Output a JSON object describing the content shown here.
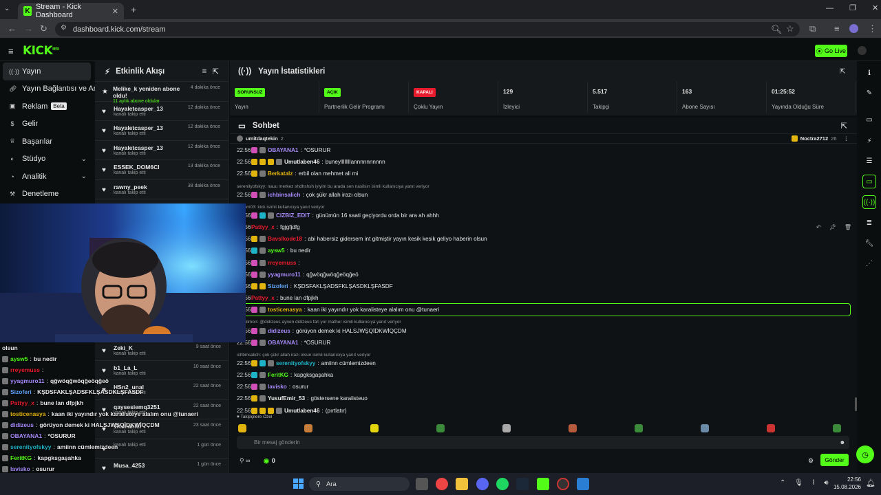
{
  "browser": {
    "tab_title": "Stream - Kick Dashboard",
    "url": "dashboard.kick.com/stream"
  },
  "header": {
    "logo": "KICK",
    "logo_sup": "BETA",
    "go_live": "Go Live"
  },
  "sidebar": {
    "items": [
      {
        "label": "Yayın",
        "icon": "broadcast-icon"
      },
      {
        "label": "Yayın Bağlantısı ve Anahtar",
        "icon": "link-icon"
      },
      {
        "label": "Reklam",
        "icon": "ad-icon",
        "badge": "Beta"
      },
      {
        "label": "Gelir",
        "icon": "dollar-icon"
      },
      {
        "label": "Başarılar",
        "icon": "trophy-icon"
      },
      {
        "label": "Stüdyo",
        "icon": "studio-icon"
      },
      {
        "label": "Analitik",
        "icon": "chart-icon"
      },
      {
        "label": "Denetleme",
        "icon": "hammer-icon"
      }
    ]
  },
  "activity": {
    "title": "Etkinlik Akışı",
    "items": [
      {
        "name": "Melike_k yeniden abone oldu!",
        "sub": "11 aylık abone oldular",
        "time": "4 dakika önce",
        "icon": "star-icon",
        "green": true
      },
      {
        "name": "Hayaletcasper_13",
        "sub": "kanalı takip etti",
        "time": "12 dakika önce",
        "icon": "heart-icon"
      },
      {
        "name": "Hayaletcasper_13",
        "sub": "kanalı takip etti",
        "time": "12 dakika önce",
        "icon": "heart-icon"
      },
      {
        "name": "Hayaletcasper_13",
        "sub": "kanalı takip etti",
        "time": "12 dakika önce",
        "icon": "heart-icon"
      },
      {
        "name": "ESSEK_DOM6CI",
        "sub": "kanalı takip etti",
        "time": "13 dakika önce",
        "icon": "heart-icon"
      },
      {
        "name": "rawny_peek",
        "sub": "kanalı takip etti",
        "time": "38 dakika önce",
        "icon": "heart-icon"
      }
    ],
    "lower_items": [
      {
        "name": "Zeki_K",
        "sub": "kanalı takip etti",
        "time": "9 saat önce"
      },
      {
        "name": "b1_La_L",
        "sub": "kanalı takip etti",
        "time": "10 saat önce"
      },
      {
        "name": "HSn2_unal",
        "sub": "kanalı takip etti",
        "time": "22 saat önce"
      },
      {
        "name": "qaysesiemq3251",
        "sub": "kanalı takip etti",
        "time": "22 saat önce"
      },
      {
        "name": "1Kullanıcı",
        "sub": "kanalı takip etti",
        "time": "23 saat önce"
      },
      {
        "name": "",
        "sub": "kanalı takip etti",
        "time": "1 gün önce"
      },
      {
        "name": "Musa_4253",
        "sub": "",
        "time": "1 gün önce"
      }
    ]
  },
  "stats": {
    "title": "Yayın İstatistikleri",
    "cells": [
      {
        "value": "SORUNSUZ",
        "label": "Yayın",
        "badge": true,
        "color": "#53fc18"
      },
      {
        "value": "AÇIK",
        "label": "Partnerlik Gelir Programı",
        "badge": true,
        "color": "#53fc18"
      },
      {
        "value": "KAPALI",
        "label": "Çoklu Yayın",
        "badge": true,
        "color": "#e81c2c"
      },
      {
        "value": "129",
        "label": "İzleyici"
      },
      {
        "value": "5.517",
        "label": "Takipçi"
      },
      {
        "value": "163",
        "label": "Abone Sayısı"
      },
      {
        "value": "01:25:52",
        "label": "Yayında Olduğu Süre"
      }
    ]
  },
  "chat": {
    "title": "Sohbet",
    "pinned_left": "umitdaqtekin",
    "pinned_left_count": "2",
    "pinned_right": "Noctra2712",
    "pinned_right_count": "26",
    "messages": [
      {
        "time": "22:56",
        "user": "OBAYANA1",
        "color": "#a78bfa",
        "text": "*OSURUR",
        "badges": [
          "pink",
          "gray"
        ]
      },
      {
        "time": "22:56",
        "user": "Umutlaben46",
        "color": "#e8e8e8",
        "text": "buneyllllllllannnnnnnnnn",
        "badges": [
          "yel",
          "yel",
          "yel",
          "gray"
        ]
      },
      {
        "time": "22:56",
        "user": "Berkatalz",
        "color": "#e2b50e",
        "text": "erbil olan mehmet ali mi",
        "badges": [
          "yel",
          "gray"
        ]
      },
      {
        "reply": "serenityofskyy: nauu merkez shdhshsh iyiyim bu arada sen nasilsın isimli kullanıcıya yanıt veriyor"
      },
      {
        "time": "22:56",
        "user": "ichbinsalich",
        "color": "#a78bfa",
        "text": "çok şükr allah irazı olsun",
        "badges": [
          "pink",
          "gray"
        ]
      },
      {
        "reply": "tazmm03: kick isimli kullanıcıya yanıt veriyor"
      },
      {
        "time": "22:56",
        "user": "CIZBIZ_EDIT",
        "color": "#a78bfa",
        "text": "günümün 16 saati geçiyordu orda bir ara ah ahhh",
        "badges": [
          "pink",
          "teal",
          "gray"
        ]
      },
      {
        "time": "22:56",
        "user": "Pattyy_x",
        "color": "#e81c2c",
        "text": "fgjgfjdfg",
        "badges": []
      },
      {
        "time": "22:56",
        "user": "Bavslkode18",
        "color": "#e81c2c",
        "text": "abi habersiz gidersem int gitmiştir yayın kesik kesik geliyo haberin olsun",
        "badges": [
          "yel",
          "gray"
        ]
      },
      {
        "time": "22:56",
        "user": "aysw5",
        "color": "#53fc18",
        "text": "bu nedir",
        "badges": [
          "teal",
          "gray"
        ]
      },
      {
        "time": "22:56",
        "user": "rreyemuss",
        "color": "#e81c2c",
        "text": "",
        "badges": [
          "pink",
          "gray"
        ]
      },
      {
        "time": "22:56",
        "user": "yyagmuro11",
        "color": "#a78bfa",
        "text": "qğwöqğwöqğeöqğeö",
        "badges": [
          "pink",
          "gray"
        ]
      },
      {
        "time": "22:56",
        "user": "Sizoferi",
        "color": "#60a5fa",
        "text": "KŞDSFAKLŞADSFKLŞASDKLŞFASDF",
        "badges": [
          "yel",
          "yel"
        ]
      },
      {
        "time": "22:56",
        "user": "Pattyy_x",
        "color": "#e81c2c",
        "text": "bune lan dfpjkh",
        "badges": []
      },
      {
        "time": "22:56",
        "user": "tosticenasya",
        "color": "#e2b50e",
        "text": "kaan iki yayındır yok karalisteye alalım onu @tunaeri",
        "badges": [
          "pink",
          "gray"
        ],
        "highlight": true
      },
      {
        "reply": "stofolimon: @didizeus aynen didizeus fah yor mather isimli kullanıcıya yanıt veriyor"
      },
      {
        "time": "22:56",
        "user": "didizeus",
        "color": "#a78bfa",
        "text": "görüyon demek ki HALSJWŞQİDKWİQÇDM",
        "badges": [
          "pink",
          "gray"
        ]
      },
      {
        "time": "22:56",
        "user": "OBAYANA1",
        "color": "#a78bfa",
        "text": "*OSURUR",
        "badges": [
          "pink",
          "gray"
        ]
      },
      {
        "reply": "ichbinsalich: çok şükr allah irazı olsun isimli kullanıcıya yanıt veriyor"
      },
      {
        "time": "22:56",
        "user": "serenityofskyy",
        "color": "#1fb3c7",
        "text": "amiinn cümlemizdeen",
        "badges": [
          "yel",
          "teal",
          "gray"
        ]
      },
      {
        "time": "22:56",
        "user": "FeritKG",
        "color": "#53fc18",
        "text": "kapgksgaşahka",
        "badges": [
          "teal",
          "gray"
        ]
      },
      {
        "time": "22:56",
        "user": "lavisko",
        "color": "#a78bfa",
        "text": "osurur",
        "badges": [
          "pink",
          "gray"
        ]
      },
      {
        "time": "22:56",
        "user": "YusufEmir_53",
        "color": "#e8e8e8",
        "text": "göstersene karalisteuo",
        "badges": [
          "yel",
          "gray"
        ]
      },
      {
        "time": "22:56",
        "user": "Umutlaben46",
        "color": "#e8e8e8",
        "text": "(pırtlatır)",
        "badges": [
          "yel",
          "yel",
          "yel",
          "gray"
        ]
      }
    ],
    "emote_label": "Takipçilere Özel",
    "input_placeholder": "Bir mesaj gönderin",
    "points": "0",
    "send": "Gönder"
  },
  "overlay_chat": [
    {
      "user": "",
      "text": "olsun",
      "color": "#e8e8e8"
    },
    {
      "user": "aysw5",
      "text": "bu nedir",
      "color": "#53fc18"
    },
    {
      "user": "rreyemuss",
      "text": "",
      "color": "#e81c2c"
    },
    {
      "user": "yyagmuro11",
      "text": "qğwöqğwöqğeöqğeö",
      "color": "#a78bfa"
    },
    {
      "user": "Sizoferi",
      "text": "KŞDSFAKLŞADSFKLŞASDKLŞFASDF",
      "color": "#60a5fa"
    },
    {
      "user": "Pattyy_x",
      "text": "bune lan dfpjkh",
      "color": "#e81c2c"
    },
    {
      "user": "tosticenasya",
      "text": "kaan iki yayındır yok karalisteye alalım onu @tunaeri",
      "color": "#e2b50e"
    },
    {
      "user": "didizeus",
      "text": "görüyon demek ki HALSJWŞQİDKWİQÇDM",
      "color": "#a78bfa"
    },
    {
      "user": "OBAYANA1",
      "text": "*OSURUR",
      "color": "#a78bfa"
    },
    {
      "user": "serenityofskyy",
      "text": "amiinn cümlemizdeen",
      "color": "#1fb3c7"
    },
    {
      "user": "FeritKG",
      "text": "kapgksgaşahka",
      "color": "#53fc18"
    },
    {
      "user": "lavisko",
      "text": "osurur",
      "color": "#a78bfa"
    },
    {
      "user": "YusufEmir_53",
      "text": "göstersene karalisteuo",
      "color": "#e8e8e8"
    },
    {
      "user": "Umutlaben46",
      "text": "(pırtlatır)",
      "color": "#e8e8e8"
    }
  ],
  "taskbar": {
    "search": "Ara",
    "time": "22:56",
    "date": "15.08.2026"
  }
}
